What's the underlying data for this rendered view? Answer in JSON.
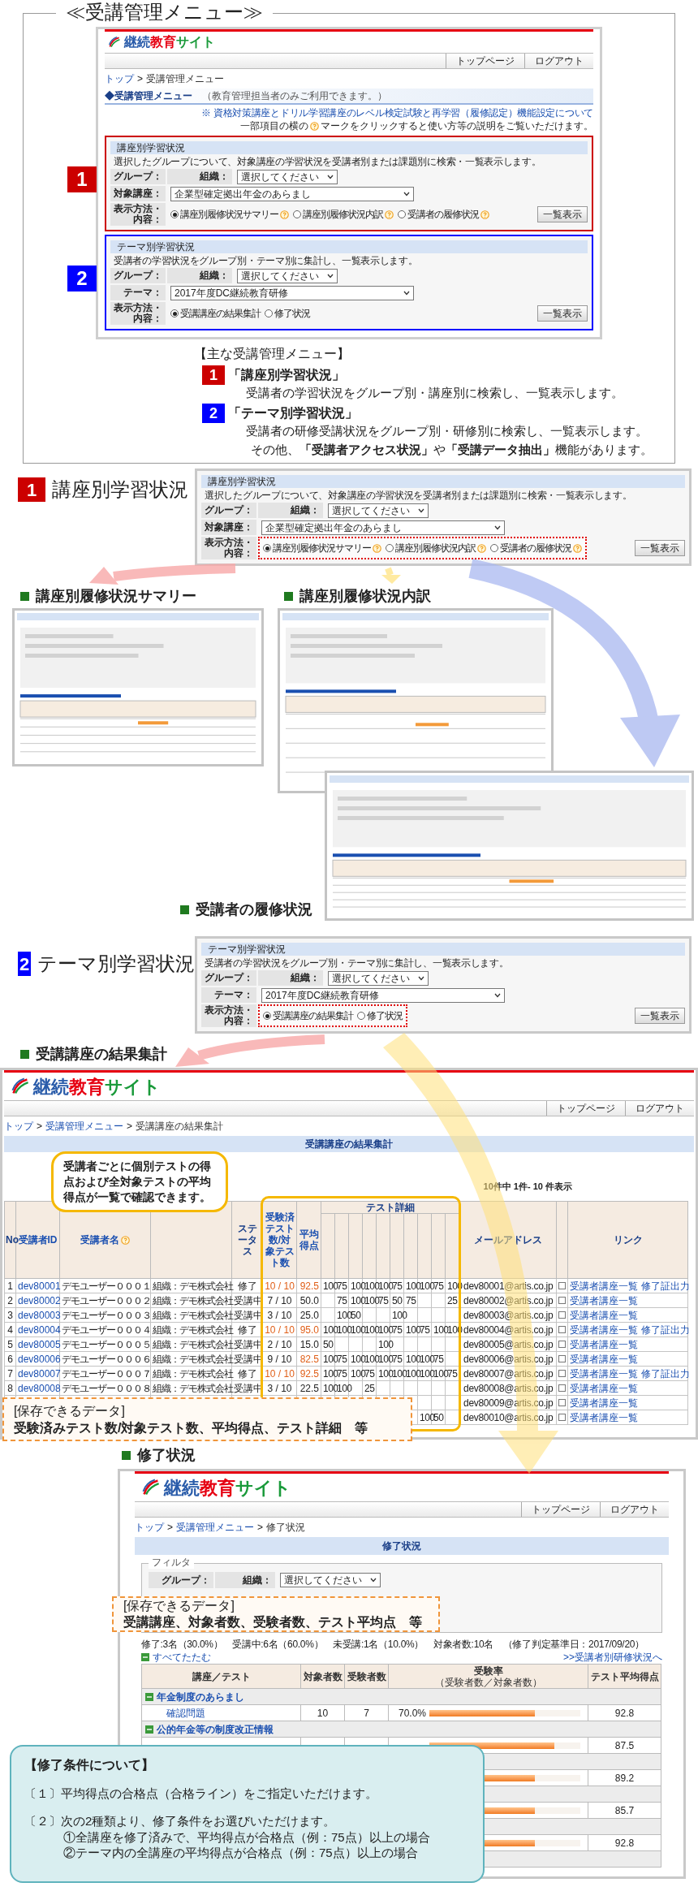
{
  "menu": {
    "title": "≪受講管理メニュー≫",
    "screenshot": {
      "logo": [
        {
          "text": "継続",
          "color": "#2a5caa"
        },
        {
          "text": "教育",
          "color": "#e60012"
        },
        {
          "text": "サイト",
          "color": "#1a9a3a"
        }
      ],
      "nav": [
        "トップページ",
        "ログアウト"
      ],
      "breadcrumb": [
        {
          "label": "トップ",
          "link": true
        },
        {
          "separator": ">",
          "label": "受講管理メニュー",
          "link": false
        }
      ],
      "heading": "◆受講管理メニュー",
      "heading_note": "（教育管理担当者のみご利用できます。）",
      "note_link": "※ 資格対策講座とドリル学習講座のレベル検定試験と再学習（履修認定）機能設定について",
      "note_help": {
        "before": "一部項目の横の",
        "after": "マークをクリックすると使い方等の説明をご覧いただけます。"
      },
      "panels": [
        {
          "number": "1",
          "color": "#cc0000",
          "highlighted": false,
          "title": "講座別学習状況",
          "description": "選択したグループについて、対象講座の学習状況を受講者別または課題別に検索・一覧表示します。",
          "group_label": "グループ：",
          "org_label": "組織：",
          "org_value": "選択してください",
          "target_label": "対象講座：",
          "target_value": "企業型確定拠出年金のあらまし",
          "display_label": "表示方法・内容：",
          "options": [
            {
              "label": "講座別履修状況サマリー",
              "selected": true,
              "help": true
            },
            {
              "label": "講座別履修状況内訳",
              "selected": false,
              "help": true
            },
            {
              "label": "受講者の履修状況",
              "selected": false,
              "help": true
            }
          ],
          "button": "一覧表示"
        },
        {
          "number": "2",
          "color": "#0000ff",
          "highlighted": false,
          "title": "テーマ別学習状況",
          "description": "受講者の学習状況をグループ別・テーマ別に集計し、一覧表示します。",
          "group_label": "グループ：",
          "org_label": "組織：",
          "org_value": "選択してください",
          "target_label": "テーマ：",
          "target_value": "2017年度DC継続教育研修",
          "display_label": "表示方法・内容：",
          "options": [
            {
              "label": "受講講座の結果集計",
              "selected": true
            },
            {
              "label": "修了状況",
              "selected": false
            }
          ],
          "button": "一覧表示"
        }
      ]
    },
    "list": {
      "heading": "【主な受講管理メニュー】",
      "items": [
        {
          "number": "1",
          "color": "#cc0000",
          "title": "「講座別学習状況」",
          "description": "受講者の学習状況をグループ別・講座別に検索し、一覧表示します。"
        },
        {
          "number": "2",
          "color": "#0000ff",
          "title": "「テーマ別学習状況」",
          "description": "受講者の研修受講状況をグループ別・研修別に検索し、一覧表示します。"
        }
      ],
      "footer": "その他、**「受講者アクセス状況」**や**「受講データ抽出」**機能があります。"
    }
  },
  "course_status": {
    "number": "1",
    "color": "#cc0000",
    "title": "講座別学習状況",
    "panel": {
      "highlighted": true,
      "title": "講座別学習状況",
      "description": "選択したグループについて、対象講座の学習状況を受講者別または課題別に検索・一覧表示します。",
      "group_label": "グループ：",
      "org_label": "組織：",
      "org_value": "選択してください",
      "target_label": "対象講座：",
      "target_value": "企業型確定拠出年金のあらまし",
      "display_label": "表示方法・内容：",
      "options": [
        {
          "label": "講座別履修状況サマリー",
          "selected": true,
          "help": true
        },
        {
          "label": "講座別履修状況内訳",
          "selected": false,
          "help": true
        },
        {
          "label": "受講者の履修状況",
          "selected": false,
          "help": true
        }
      ],
      "button": "一覧表示"
    },
    "views": [
      {
        "title": "講座別履修状況サマリー"
      },
      {
        "title": "講座別履修状況内訳"
      },
      {
        "title": "受講者の履修状況"
      }
    ]
  },
  "theme_status": {
    "number": "2",
    "color": "#0000ff",
    "title": "テーマ別学習状況",
    "panel": {
      "highlighted": true,
      "title": "テーマ別学習状況",
      "description": "受講者の学習状況をグループ別・テーマ別に集計し、一覧表示します。",
      "group_label": "グループ：",
      "org_label": "組織：",
      "org_value": "選択してください",
      "target_label": "テーマ：",
      "target_value": "2017年度DC継続教育研修",
      "display_label": "表示方法・内容：",
      "options": [
        {
          "label": "受講講座の結果集計",
          "selected": true
        },
        {
          "label": "修了状況",
          "selected": false
        }
      ],
      "button": "一覧表示"
    },
    "results": {
      "title": "受講講座の結果集計",
      "screenshot": {
        "logo": [
          {
            "text": "継続",
            "color": "#2a5caa"
          },
          {
            "text": "教育",
            "color": "#e60012"
          },
          {
            "text": "サイト",
            "color": "#1a9a3a"
          }
        ],
        "nav": [
          "トップページ",
          "ログアウト"
        ],
        "breadcrumb": [
          {
            "label": "トップ",
            "link": true
          },
          {
            "separator": ">",
            "label": "受講管理メニュー",
            "link": true
          },
          {
            "separator": ">",
            "label": "受講講座の結果集計",
            "link": false
          }
        ],
        "page_title": "受講講座の結果集計",
        "count": "10件中 1件- 10 件表示",
        "header": {
          "no": "No",
          "id": "受講者ID",
          "name": "受講者名",
          "status": "ステータス",
          "tests": "受験済テスト数/対象テスト数",
          "average": "平均得点",
          "test_details": "テスト詳細",
          "email": "メールアドレス",
          "links": "リンク"
        },
        "rows": [
          {
            "no": "1",
            "id": "dev80001",
            "name": "デモユーザー０００１",
            "group": "組織：デモ株式会社",
            "status": "修了",
            "completed": true,
            "tests": "10 / 10",
            "average": "92.5",
            "passed": true,
            "scores": {
              "test_1": "100",
              "test_2": "75",
              "test_3": "100",
              "test_4": "100",
              "test_5": "100",
              "test_6": "75",
              "test_7": "100",
              "test_8": "100",
              "test_9": "75",
              "test_10": "100"
            },
            "email": "dev80001@artis.co.jp",
            "checked": false,
            "links": [
              "受講者講座一覧",
              "修了証出力"
            ]
          },
          {
            "no": "2",
            "id": "dev80002",
            "name": "デモユーザー０００２",
            "group": "組織：デモ株式会社",
            "status": "受講中",
            "completed": false,
            "tests": "7 / 10",
            "average": "50.0",
            "passed": false,
            "scores": {
              "test_2": "75",
              "test_3": "100",
              "test_4": "100",
              "test_5": "75",
              "test_6": "50",
              "test_7": "75",
              "test_10": "25"
            },
            "email": "dev80002@artis.co.jp",
            "checked": false,
            "links": [
              "受講者講座一覧"
            ]
          },
          {
            "no": "3",
            "id": "dev80003",
            "name": "デモユーザー０００３",
            "group": "組織：デモ株式会社",
            "status": "受講中",
            "completed": false,
            "tests": "3 / 10",
            "average": "25.0",
            "passed": false,
            "scores": {
              "test_2": "100",
              "test_3": "50",
              "test_6": "100"
            },
            "email": "dev80003@artis.co.jp",
            "checked": false,
            "links": [
              "受講者講座一覧"
            ]
          },
          {
            "no": "4",
            "id": "dev80004",
            "name": "デモユーザー０００４",
            "group": "組織：デモ株式会社",
            "status": "修了",
            "completed": true,
            "tests": "10 / 10",
            "average": "95.0",
            "passed": true,
            "scores": {
              "test_1": "100",
              "test_2": "100",
              "test_3": "100",
              "test_4": "100",
              "test_5": "100",
              "test_6": "75",
              "test_7": "100",
              "test_8": "75",
              "test_9": "100",
              "test_10": "100"
            },
            "email": "dev80004@artis.co.jp",
            "checked": false,
            "links": [
              "受講者講座一覧",
              "修了証出力"
            ]
          },
          {
            "no": "5",
            "id": "dev80005",
            "name": "デモユーザー０００５",
            "group": "組織：デモ株式会社",
            "status": "受講中",
            "completed": false,
            "tests": "2 / 10",
            "average": "15.0",
            "passed": false,
            "scores": {
              "test_1": "50",
              "test_5": "100"
            },
            "email": "dev80005@artis.co.jp",
            "checked": false,
            "links": [
              "受講者講座一覧"
            ]
          },
          {
            "no": "6",
            "id": "dev80006",
            "name": "デモユーザー０００６",
            "group": "組織：デモ株式会社",
            "status": "受講中",
            "completed": false,
            "tests": "9 / 10",
            "average": "82.5",
            "passed": true,
            "scores": {
              "test_1": "100",
              "test_2": "75",
              "test_3": "100",
              "test_4": "100",
              "test_5": "100",
              "test_6": "75",
              "test_7": "100",
              "test_8": "100",
              "test_9": "75"
            },
            "email": "dev80006@artis.co.jp",
            "checked": false,
            "links": [
              "受講者講座一覧"
            ]
          },
          {
            "no": "7",
            "id": "dev80007",
            "name": "デモユーザー０００７",
            "group": "組織：デモ株式会社",
            "status": "修了",
            "completed": true,
            "tests": "10 / 10",
            "average": "92.5",
            "passed": true,
            "scores": {
              "test_1": "100",
              "test_2": "75",
              "test_3": "100",
              "test_4": "75",
              "test_5": "100",
              "test_6": "100",
              "test_7": "100",
              "test_8": "100",
              "test_9": "100",
              "test_10": "75"
            },
            "email": "dev80007@artis.co.jp",
            "checked": false,
            "links": [
              "受講者講座一覧",
              "修了証出力"
            ]
          },
          {
            "no": "8",
            "id": "dev80008",
            "name": "デモユーザー０００８",
            "group": "組織：デモ株式会社",
            "status": "受講中",
            "completed": false,
            "tests": "3 / 10",
            "average": "22.5",
            "passed": false,
            "scores": {
              "test_1": "100",
              "test_2": "100",
              "test_4": "25"
            },
            "email": "dev80008@artis.co.jp",
            "checked": false,
            "links": [
              "受講者講座一覧"
            ]
          },
          {
            "email": "dev80009@artis.co.jp",
            "checked": false,
            "links": [
              "受講者講座一覧"
            ]
          },
          {
            "scores": {
              "test_8": "100",
              "test_9": "50"
            },
            "email": "dev80010@artis.co.jp",
            "checked": false,
            "links": [
              "受講者講座一覧"
            ]
          }
        ]
      },
      "bubble": "受講者ごとに個別テストの得点および全対象テストの平均得点が一覧で確認できます。",
      "note": {
        "heading": "[保存できるデータ]",
        "body": "受験済みテスト数/対象テスト数、平均得点、テスト詳細　等"
      }
    },
    "completion": {
      "title": "修了状況",
      "screenshot": {
        "logo": [
          {
            "text": "継続",
            "color": "#2a5caa"
          },
          {
            "text": "教育",
            "color": "#e60012"
          },
          {
            "text": "サイト",
            "color": "#1a9a3a"
          }
        ],
        "nav": [
          "トップページ",
          "ログアウト"
        ],
        "breadcrumb": [
          {
            "label": "トップ",
            "link": true
          },
          {
            "separator": ">",
            "label": "受講管理メニュー",
            "link": true
          },
          {
            "separator": ">",
            "label": "修了状況",
            "link": false
          }
        ],
        "page_title": "修了状況",
        "filter": {
          "legend": "フィルタ",
          "group_label": "グループ：",
          "org_label": "組織：",
          "org_value": "選択してください"
        },
        "summary": "修了:3名（30.0%）　受講中:6名（60.0%）　未受講:1名（10.0%）　対象者数:10名　（修了判定基準日：2017/09/20）",
        "collapse": "すべてたたむ",
        "link": ">>受講者別研修状況へ",
        "columns": [
          {
            "label": "講座／テスト"
          },
          {
            "label": "対象者数"
          },
          {
            "label": "受験者数"
          },
          {
            "label": "受験率",
            "sublabel": "（受験者数／対象者数）"
          },
          {
            "label": "テスト平均得点"
          }
        ],
        "rows": [
          {
            "kind": "group",
            "name": "年金制度のあらまし",
            "expanded": true
          },
          {
            "kind": "item",
            "name": "確認問題",
            "target": "10",
            "examinees": "7",
            "rate": "70.0%",
            "level": 0.7,
            "average": "92.8"
          },
          {
            "kind": "group",
            "name": "公的年金等の制度改正情報",
            "expanded": true
          },
          {
            "kind": "item",
            "level": 0.83,
            "average": "87.5"
          },
          {
            "kind": "group"
          },
          {
            "kind": "item",
            "level": 0.7,
            "average": "89.2"
          },
          {
            "kind": "group"
          },
          {
            "kind": "item",
            "level": 0.7,
            "average": "85.7"
          },
          {
            "kind": "group"
          },
          {
            "kind": "item",
            "level": 0.7,
            "average": "92.8"
          },
          {
            "kind": "group"
          }
        ]
      },
      "note": {
        "heading": "[保存できるデータ]",
        "body": "受講講座、対象者数、受験者数、テスト平均点　等"
      },
      "conditions": {
        "title": "【修了条件について】",
        "items": [
          {
            "text": "〔１〕平均得点の合格点（合格ライン）をご指定いただけます。"
          },
          {
            "text": "〔２〕次の2種類より、修了条件をお選びいただけます。",
            "children": [
              {
                "text": "①全講座を修了済みで、平均得点が合格点（例：75点）以上の場合"
              },
              {
                "text": "②テーマ内の全講座の平均得点が合格点（例：75点）以上の場合"
              }
            ]
          }
        ]
      }
    }
  }
}
